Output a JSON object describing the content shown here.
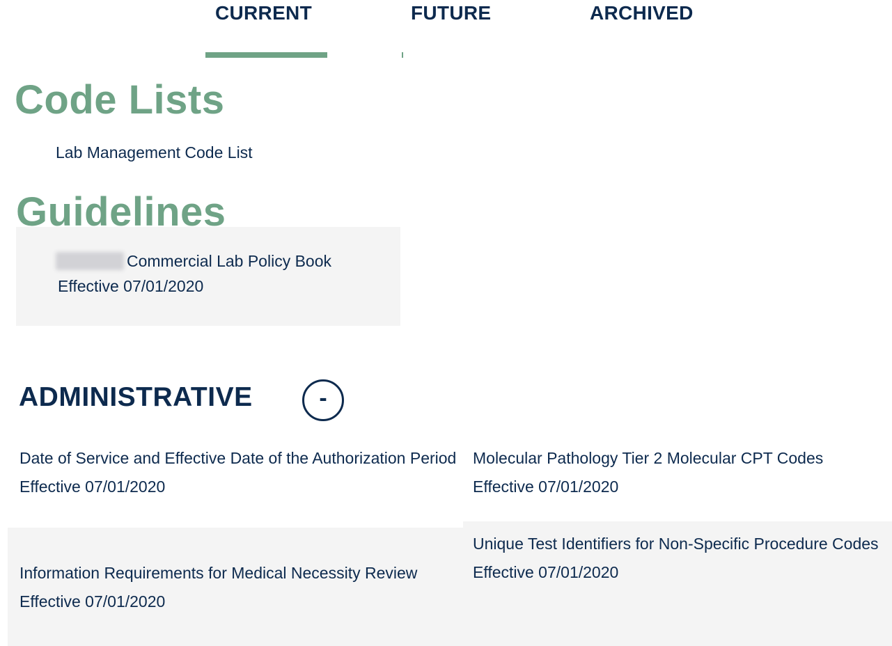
{
  "tabs": {
    "current": "CURRENT",
    "future": "FUTURE",
    "archived": "ARCHIVED"
  },
  "code_lists": {
    "title": "Code Lists",
    "items": [
      {
        "label": "Lab Management Code List"
      }
    ]
  },
  "guidelines": {
    "title": "Guidelines",
    "items": [
      {
        "label": "Commercial Lab Policy Book",
        "effective": "Effective 07/01/2020"
      }
    ]
  },
  "administrative": {
    "title": "ADMINISTRATIVE",
    "toggle_label": "-",
    "items": [
      {
        "label": "Date of Service and Effective Date of the Authorization Period",
        "effective": "Effective 07/01/2020"
      },
      {
        "label": "Molecular Pathology Tier 2 Molecular CPT Codes",
        "effective": "Effective 07/01/2020"
      },
      {
        "label": "Information Requirements for Medical Necessity Review",
        "effective": "Effective 07/01/2020"
      },
      {
        "label": "Unique Test Identifiers for Non-Specific Procedure Codes",
        "effective": "Effective 07/01/2020"
      }
    ]
  },
  "colors": {
    "accent_green": "#6fa386",
    "navy_text": "#0d2a4e",
    "card_background": "#f4f4f4"
  }
}
